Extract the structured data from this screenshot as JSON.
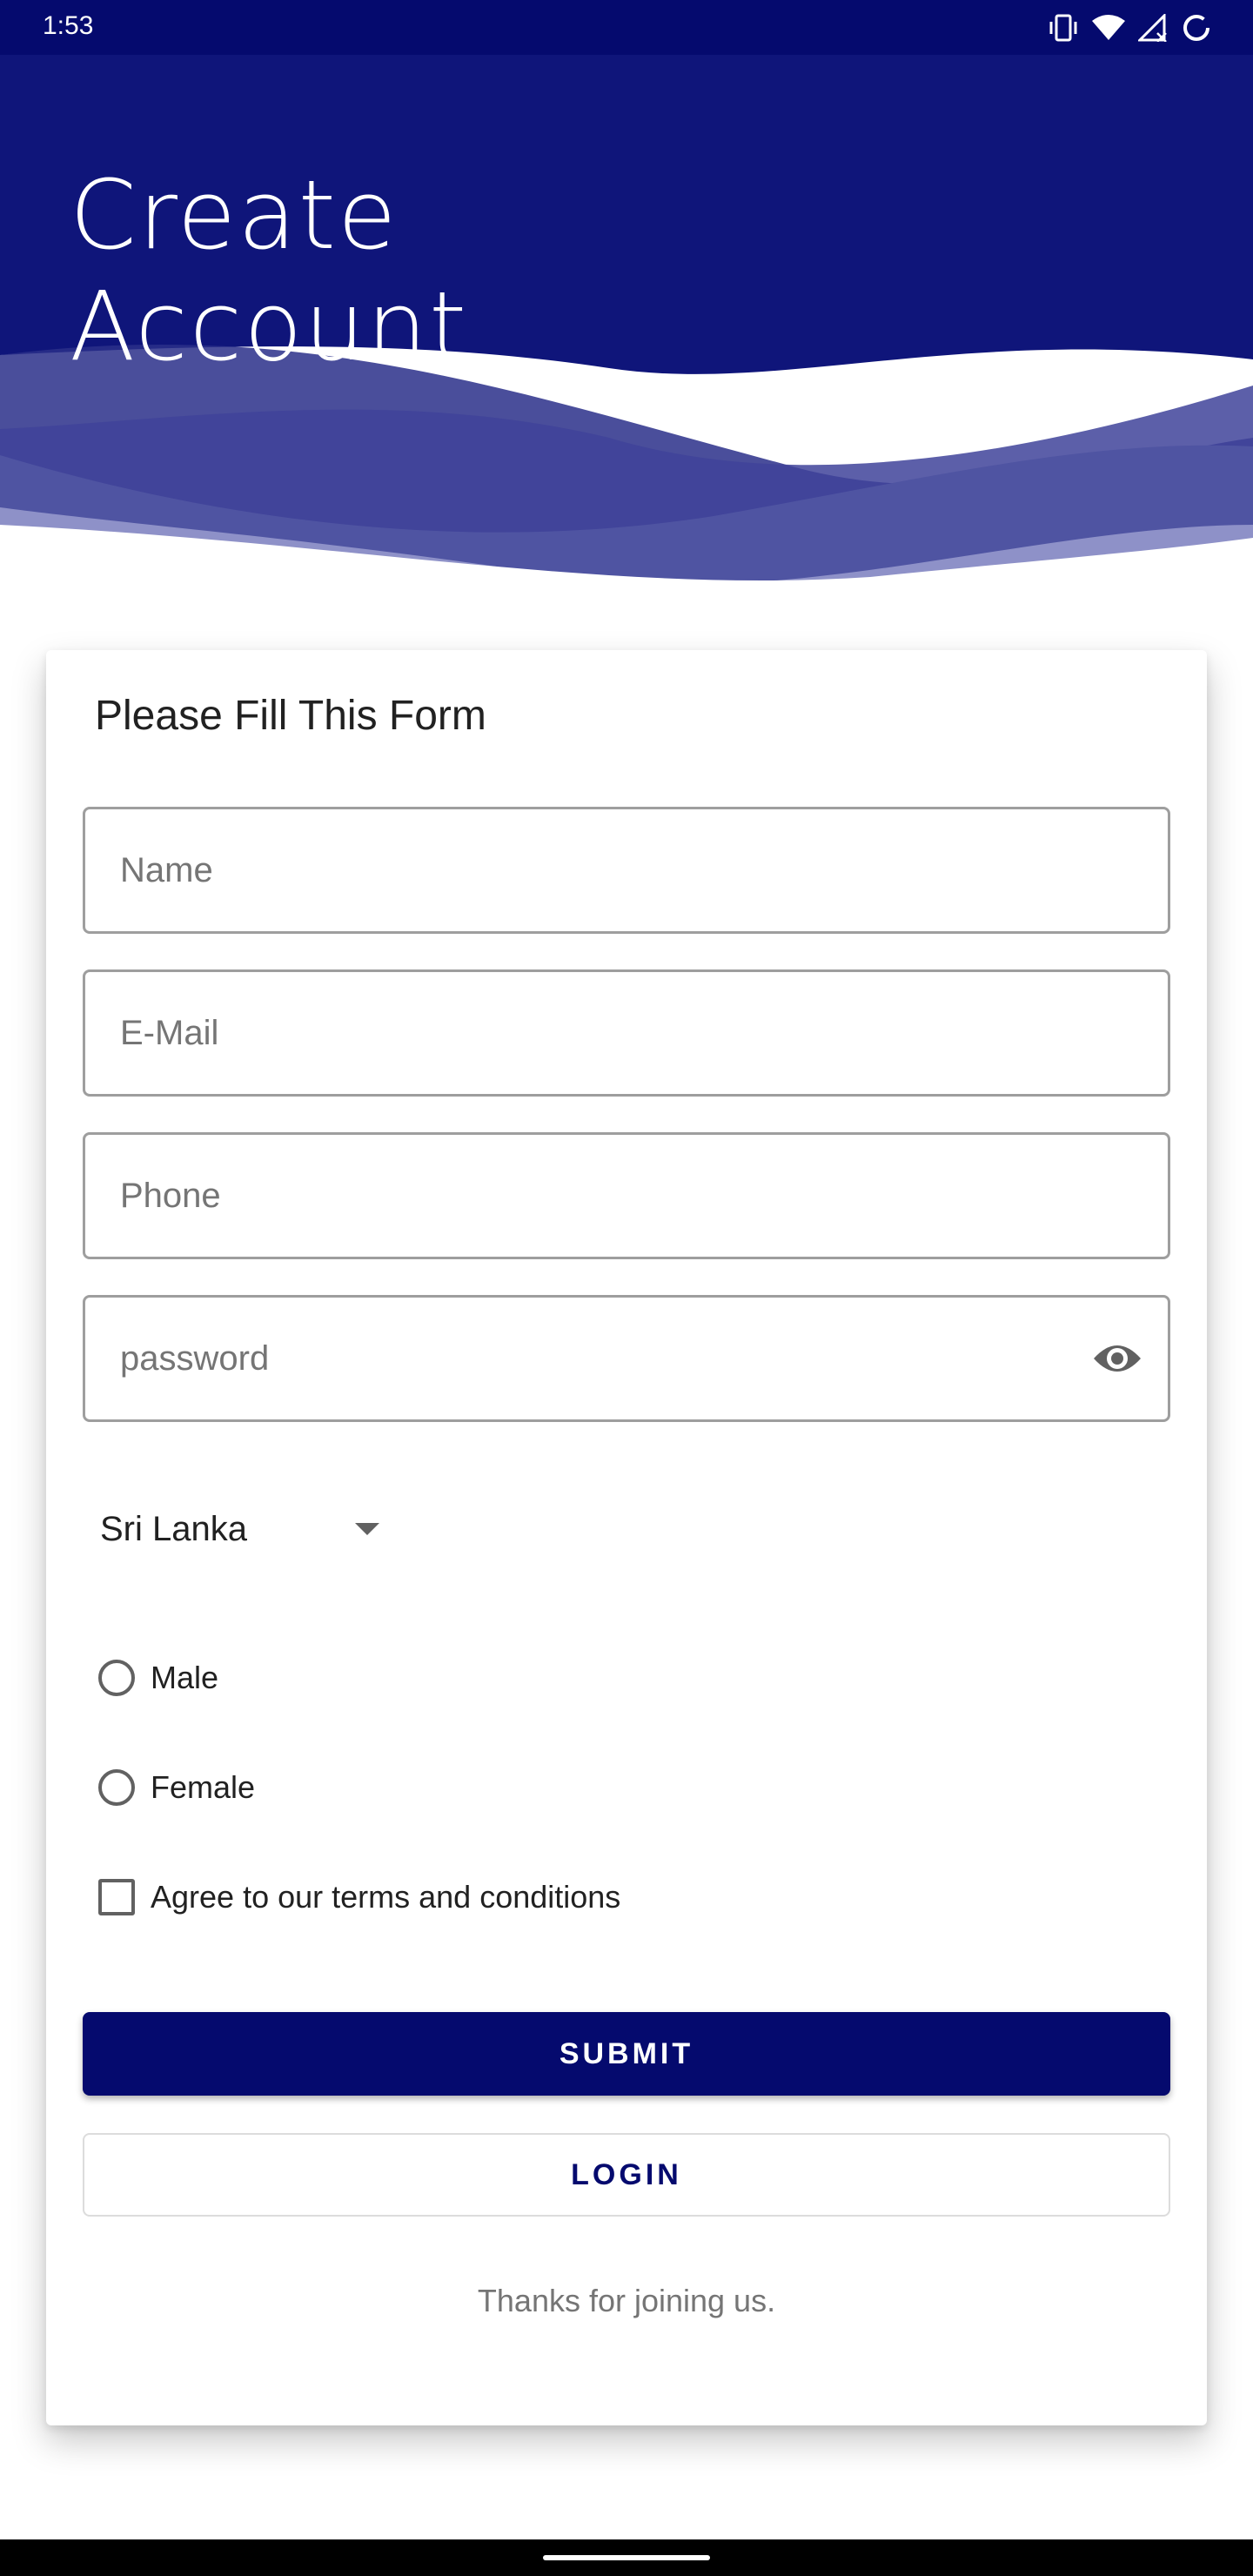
{
  "status_bar": {
    "time": "1:53",
    "icons": [
      "vibrate-icon",
      "wifi-icon",
      "signal-icon",
      "battery-icon"
    ]
  },
  "header": {
    "title_line1": "Create",
    "title_line2": "Account"
  },
  "form": {
    "title": "Please Fill This Form",
    "name_placeholder": "Name",
    "email_placeholder": "E-Mail",
    "phone_placeholder": "Phone",
    "password_placeholder": "password",
    "country_selected": "Sri Lanka",
    "gender_options": [
      "Male",
      "Female"
    ],
    "terms_label": "Agree to our terms and conditions",
    "submit_label": "SUBMIT",
    "login_label": "LOGIN",
    "footer_text": "Thanks for joining us."
  },
  "colors": {
    "primary": "#050a6e",
    "header_background": "#0f157a",
    "field_border": "#9e9e9e",
    "hint_text": "#757575"
  }
}
